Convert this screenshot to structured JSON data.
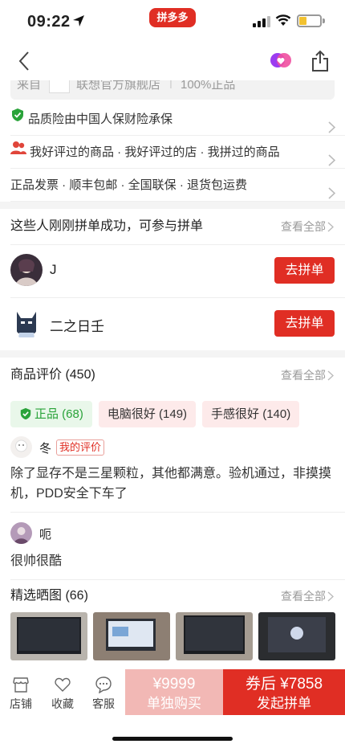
{
  "status": {
    "time": "09:22",
    "brand_badge": "拼多多"
  },
  "shop_strip": {
    "from": "来自",
    "shop": "联想官方旗舰店",
    "tag": "100%正品"
  },
  "service_rows": [
    {
      "label": "品质险由中国人保财险承保"
    },
    {
      "label": "我好评过的商品 · 我好评过的店 · 我拼过的商品"
    },
    {
      "label": "正品发票 · 顺丰包邮 · 全国联保 · 退货包运费"
    }
  ],
  "group_section": {
    "title": "这些人刚刚拼单成功，可参与拼单",
    "more": "查看全部",
    "items": [
      {
        "name": "J",
        "button": "去拼单"
      },
      {
        "name": "二之日壬",
        "button": "去拼单"
      }
    ]
  },
  "reviews_section": {
    "title": "商品评价 (450)",
    "more": "查看全部",
    "tags": [
      {
        "label": "正品 (68)"
      },
      {
        "label": "电脑很好 (149)"
      },
      {
        "label": "手感很好 (140)"
      }
    ],
    "reviews": [
      {
        "user": "冬",
        "badge": "我的评价",
        "text": "除了显存不是三星颗粒，其他都满意。验机通过，非摸摸机，PDD安全下车了"
      },
      {
        "user": "呃",
        "badge": "",
        "text": "很帅很酷"
      }
    ]
  },
  "photos_section": {
    "title": "精选晒图 (66)",
    "more": "查看全部"
  },
  "bottom": {
    "shop": "店铺",
    "fav": "收藏",
    "service": "客服",
    "solo_price": "¥9999",
    "solo_label": "单独购买",
    "group_price": "券后 ¥7858",
    "group_label": "发起拼单"
  },
  "colors": {
    "accent": "#e02e24",
    "good_green": "#2aa33a",
    "solo_button": "#f2b8b5"
  }
}
